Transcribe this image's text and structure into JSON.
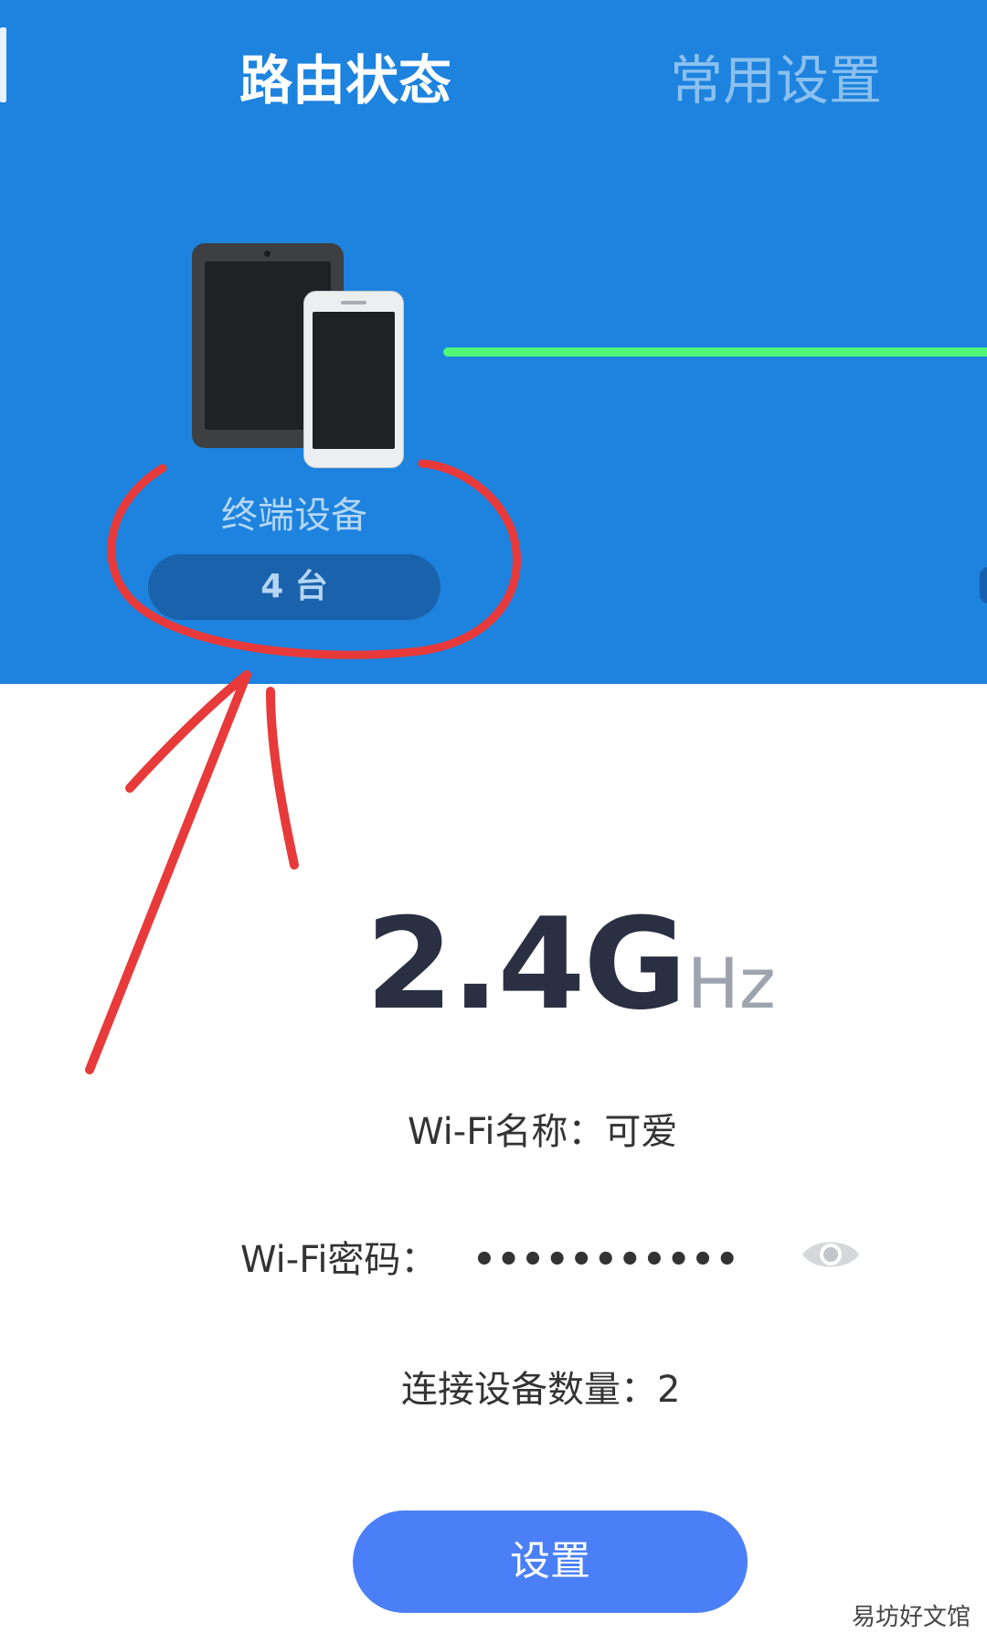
{
  "header": {
    "tabs": [
      {
        "label": "路由状态",
        "active": true
      },
      {
        "label": "常用设置",
        "active": false
      }
    ]
  },
  "terminal": {
    "label": "终端设备",
    "count": "4 台",
    "link_color": "#4ff579"
  },
  "band": {
    "value": "2.4G",
    "unit": "Hz"
  },
  "wifi": {
    "name_label": "Wi-Fi名称：可爱",
    "password_label": "Wi-Fi密码：",
    "password_mask": "•••••••••••",
    "connected_label": "连接设备数量：2"
  },
  "actions": {
    "settings_label": "设置"
  },
  "watermark": "易坊好文馆",
  "colors": {
    "primary_blue": "#1d83de",
    "button_blue": "#4a7ff7",
    "annotation_red": "#e83a3a"
  }
}
